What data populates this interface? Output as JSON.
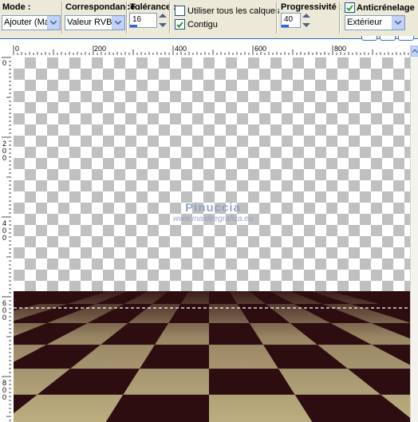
{
  "toolbar": {
    "mode": {
      "label": "Mode :",
      "value": "Ajouter (Maj)"
    },
    "match": {
      "label": "Correspondance :",
      "value": "Valeur RVB"
    },
    "tolerance": {
      "label": "Tolérance :",
      "value": "16"
    },
    "use_all_layers": {
      "label": "Utiliser tous les calques",
      "checked": false
    },
    "contiguous": {
      "label": "Contigu",
      "checked": true
    },
    "feather": {
      "label": "Progressivité :",
      "value": "40"
    },
    "antialias": {
      "label": "Anticrénelage",
      "checked": true,
      "value": "Extérieur"
    }
  },
  "rulers": {
    "horizontal_labels": [
      "0",
      "200",
      "400",
      "600",
      "800"
    ],
    "vertical_labels": [
      "0",
      "200",
      "400",
      "600",
      "800"
    ]
  },
  "watermark": {
    "line1": "Pinuccia",
    "line2": "www.maidiregrafica.eu"
  },
  "colors": {
    "floor_dark": "#2d0d10",
    "floor_light": "#bcae80",
    "selection": "#ffffff",
    "checker_gray": "#c0c0c0",
    "accent": "#316ac5"
  }
}
